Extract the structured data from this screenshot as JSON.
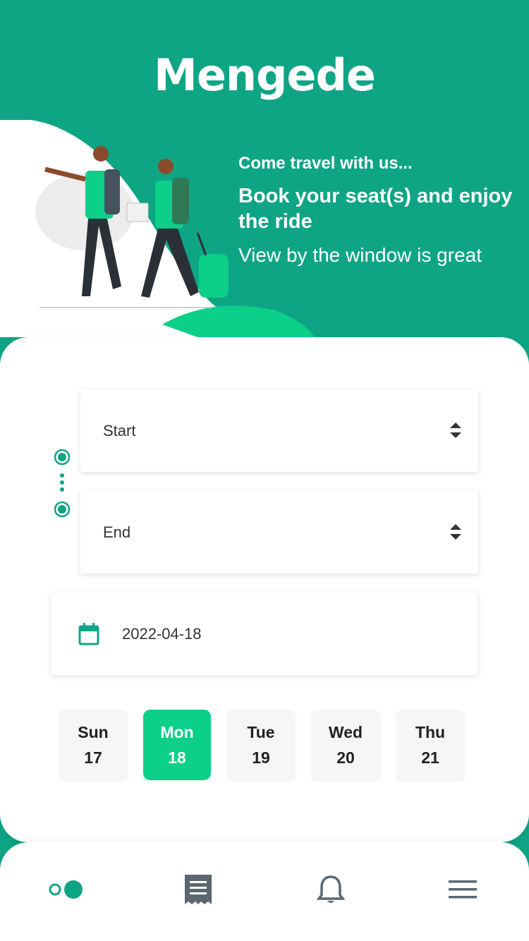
{
  "app": {
    "name": "Mengede",
    "brand_color": "#0ea585",
    "accent_color": "#0ccf8a"
  },
  "hero": {
    "subtitle": "Come travel with us...",
    "title": "Book your seat(s) and enjoy the ride",
    "tagline": "View by the window is great",
    "illustration": "travelers-illustration"
  },
  "booking": {
    "start_label": "Start",
    "end_label": "End",
    "date_value": "2022-04-18",
    "date_icon": "calendar-icon",
    "route_icon": "route-dots-icon",
    "select_icon": "sort-arrows-icon"
  },
  "days": [
    {
      "day": "Sun",
      "date": "17",
      "selected": false
    },
    {
      "day": "Mon",
      "date": "18",
      "selected": true
    },
    {
      "day": "Tue",
      "date": "19",
      "selected": false
    },
    {
      "day": "Wed",
      "date": "20",
      "selected": false
    },
    {
      "day": "Thu",
      "date": "21",
      "selected": false
    }
  ],
  "bottom_nav": [
    {
      "name": "home",
      "icon": "dots-toggle-icon",
      "active": true
    },
    {
      "name": "tickets",
      "icon": "receipt-icon",
      "active": false
    },
    {
      "name": "notifications",
      "icon": "bell-icon",
      "active": false
    },
    {
      "name": "menu",
      "icon": "hamburger-menu-icon",
      "active": false
    }
  ]
}
